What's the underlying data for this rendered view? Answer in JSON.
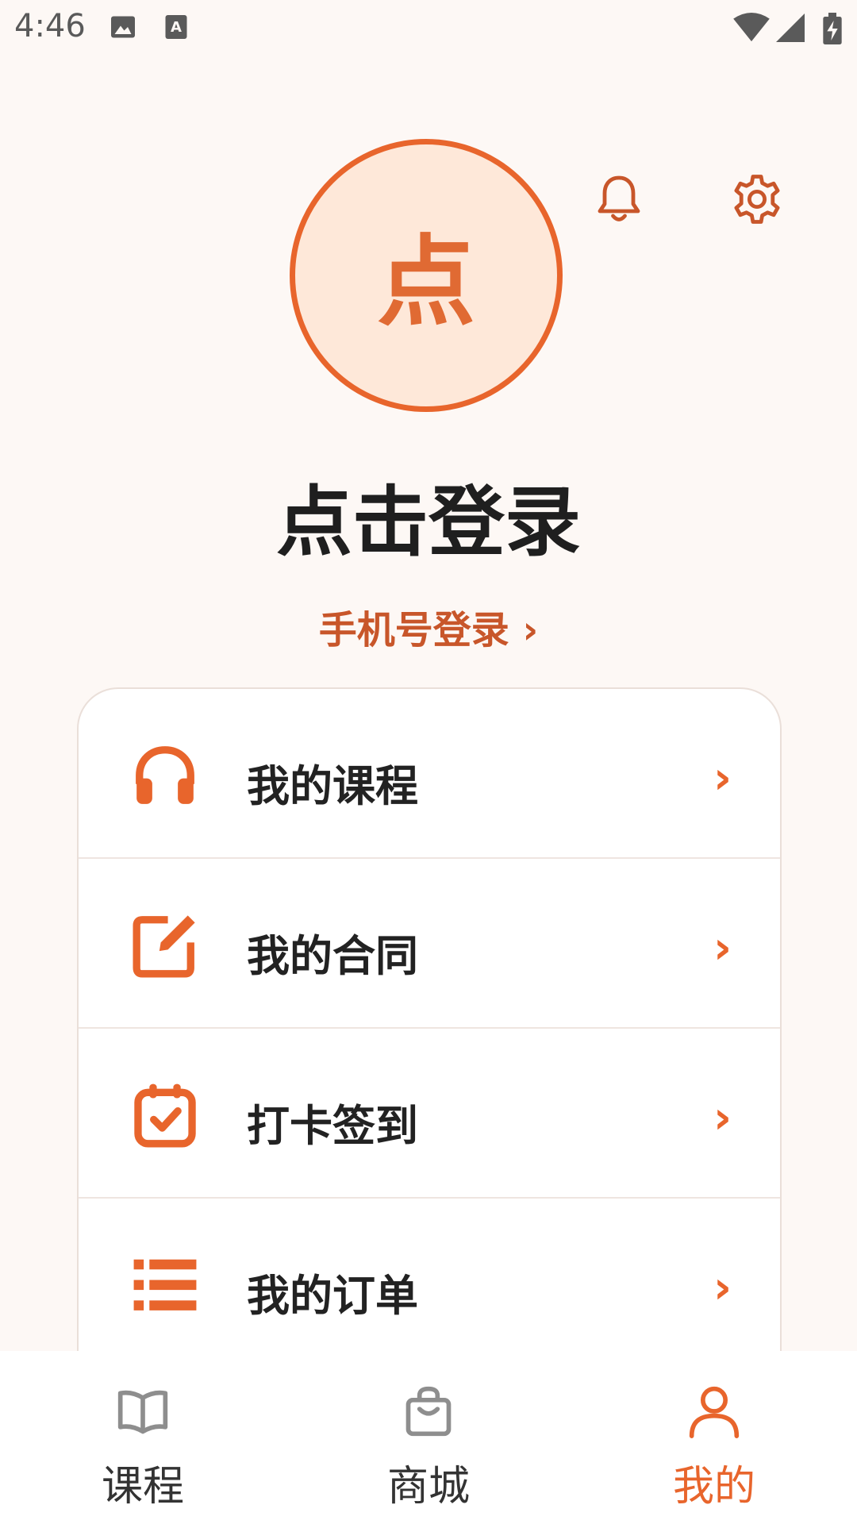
{
  "status_bar": {
    "time": "4:46",
    "icons": [
      "image-icon",
      "text-a-icon",
      "wifi-icon",
      "signal-icon",
      "battery-charging-icon"
    ]
  },
  "header": {
    "avatar_text": "点",
    "icons": [
      "bell-icon",
      "gear-icon"
    ]
  },
  "login": {
    "title": "点击登录",
    "phone_login": "手机号登录 ›"
  },
  "menu": {
    "items": [
      {
        "label": "我的课程",
        "icon": "headphones-icon"
      },
      {
        "label": "我的合同",
        "icon": "edit-icon"
      },
      {
        "label": "打卡签到",
        "icon": "calendar-check-icon"
      },
      {
        "label": "我的订单",
        "icon": "list-icon"
      }
    ],
    "chevron": "›"
  },
  "tab_bar": {
    "tabs": [
      {
        "label": "课程",
        "icon": "book-icon",
        "active": false
      },
      {
        "label": "商城",
        "icon": "shopping-bag-icon",
        "active": false
      },
      {
        "label": "我的",
        "icon": "person-icon",
        "active": true
      }
    ]
  },
  "colors": {
    "accent": "#E8652C",
    "avatar_fill": "#FEE8D9",
    "background": "#FDF8F5",
    "text": "#222222",
    "inactive_icon": "#8E8E8E"
  }
}
